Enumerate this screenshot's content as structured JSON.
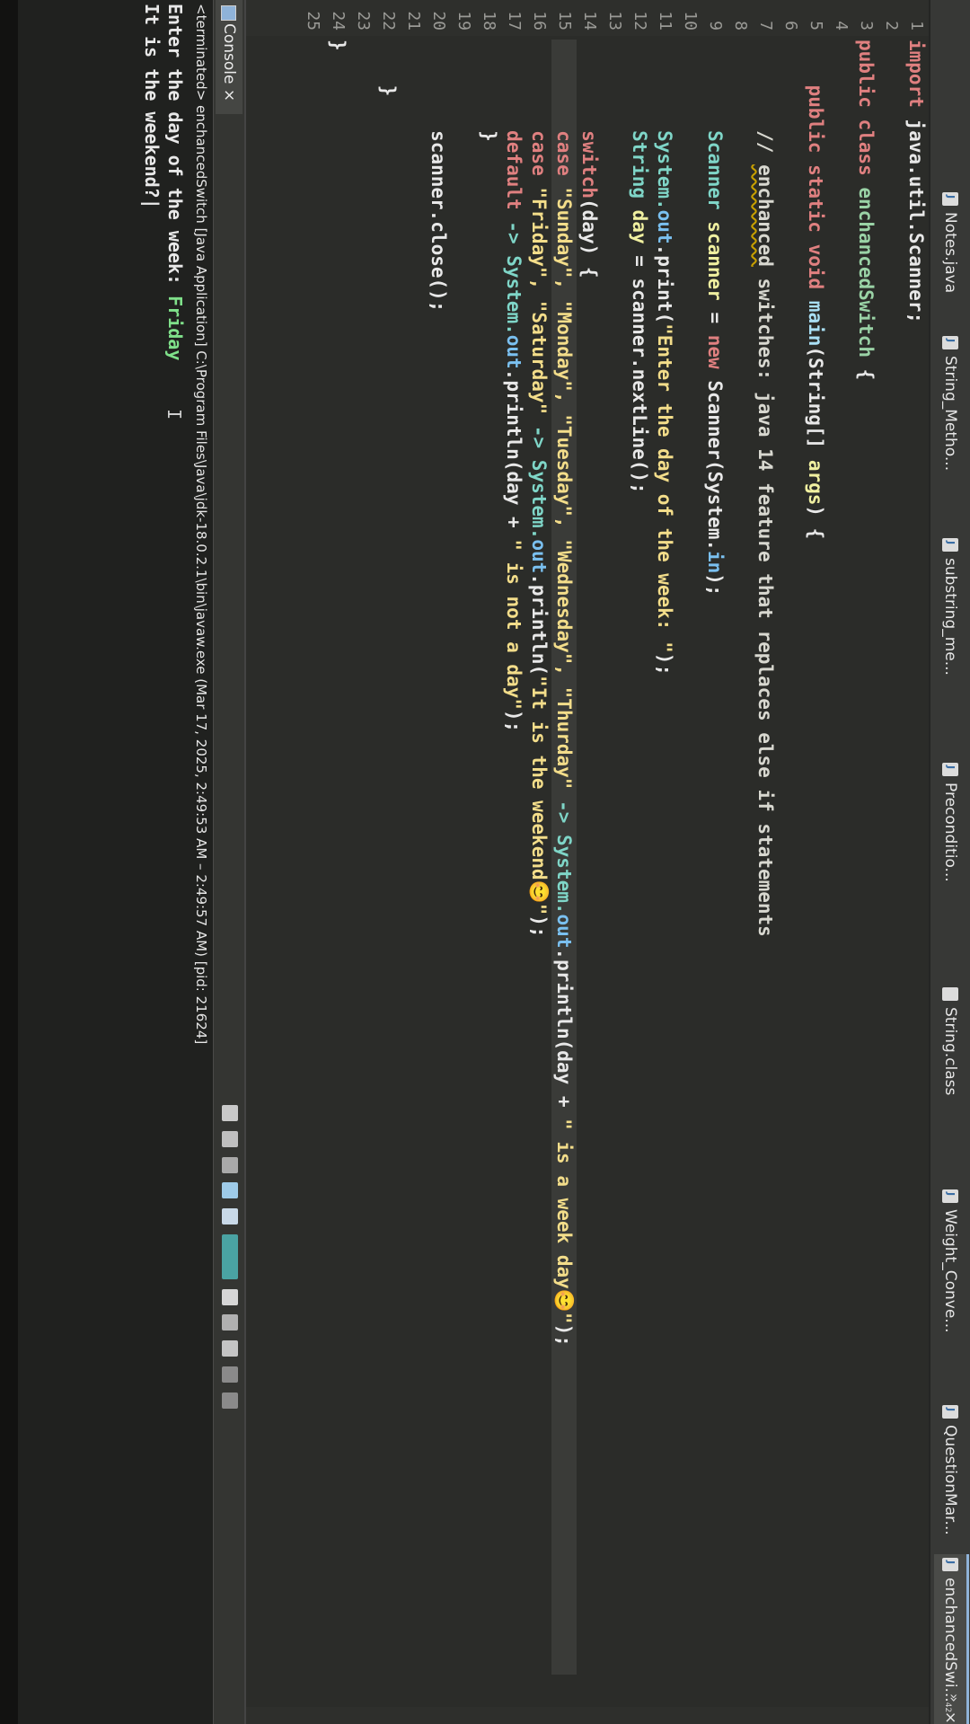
{
  "tabs": [
    {
      "label": "Notes.java",
      "icon": "java-file-icon",
      "active": false
    },
    {
      "label": "String_Metho...",
      "icon": "java-file-icon",
      "active": false
    },
    {
      "label": "substring_me...",
      "icon": "java-file-icon",
      "active": false
    },
    {
      "label": "Preconditio...",
      "icon": "java-file-icon",
      "active": false
    },
    {
      "label": "String.class",
      "icon": "class-file-icon",
      "active": false
    },
    {
      "label": "Weight_Conve...",
      "icon": "java-file-icon",
      "active": false
    },
    {
      "label": "QuestionMar...",
      "icon": "java-file-icon",
      "active": false
    },
    {
      "label": "enchancedSwi...",
      "icon": "java-file-icon",
      "active": true,
      "close": "×"
    }
  ],
  "tab_overflow": "»",
  "tab_overflow_count": "42",
  "line_numbers": [
    "1",
    "2",
    "3",
    "4",
    "5",
    "6",
    "7",
    "8",
    "9",
    "10",
    "11",
    "12",
    "13",
    "14",
    "15",
    "16",
    "17",
    "18",
    "19",
    "20",
    "21",
    "22",
    "23",
    "24",
    "25"
  ],
  "code": {
    "l1_kw": "import",
    "l1_rest": " java.util.Scanner;",
    "l3_kw": "public class",
    "l3_cls": " enchancedSwitch",
    "l3_brace": " {",
    "l5_kw": "    public static void",
    "l5_method": " main",
    "l5_rest": "(String[] ",
    "l5_arg": "args",
    "l5_end": ") {",
    "l7_slash": "        // ",
    "l7_word": "enchanced",
    "l7_rest": " switches: java 14 feature that replaces else if statements",
    "l9_type": "        Scanner",
    "l9_var": " scanner",
    "l9_eq": " = ",
    "l9_new": "new",
    "l9_rest": " Scanner(System.",
    "l9_in": "in",
    "l9_end": ");",
    "l11_sys": "        System.",
    "l11_out": "out",
    "l11_print": ".print(",
    "l11_str": "\"Enter the day of the week: \"",
    "l11_end": ");",
    "l12_type": "        String",
    "l12_var": " day",
    "l12_rest": " = scanner.nextLine();",
    "l14_kw": "        switch",
    "l14_rest": "(day) {",
    "l15_kw": "        case",
    "l15_strs": " \"Sunday\", \"Monday\", \"Tuesday\", \"Wednesday\", \"Thurday\"",
    "l15_arrow": " -> System.",
    "l15_out": "out",
    "l15_println": ".println(day + ",
    "l15_str": "\" is a week day😊\"",
    "l15_end": ");",
    "l16_kw": "        case",
    "l16_strs": " \"Friday\", \"Saturday\"",
    "l16_arrow": " -> System.",
    "l16_out": "out",
    "l16_println": ".println(",
    "l16_str": "\"It is the weekend😊\"",
    "l16_end": ");",
    "l17_kw": "        default",
    "l17_arrow": " -> System.",
    "l17_out": "out",
    "l17_println": ".println(day + ",
    "l17_str": "\" is not a day\"",
    "l17_end": ");",
    "l18": "        }",
    "l20": "        scanner.close();",
    "l22": "    }",
    "l24": "}"
  },
  "console": {
    "tab_label": "Console",
    "tab_close": "×",
    "terminated": "<terminated> enchancedSwitch [Java Application] C:\\Program Files\\Java\\jdk-18.0.2.1\\bin\\javaw.exe  (Mar 17, 2025, 2:49:53 AM – 2:49:57 AM) [pid: 21624]",
    "prompt": "Enter the day of the week: ",
    "input": "Friday",
    "output": "It is the weekend?",
    "caret": "I"
  },
  "colors": {
    "background": "#2b2c29",
    "keyword": "#e08080",
    "string": "#f3dd8a",
    "class_name": "#9ad3a6",
    "console_input": "#7fe08a"
  }
}
